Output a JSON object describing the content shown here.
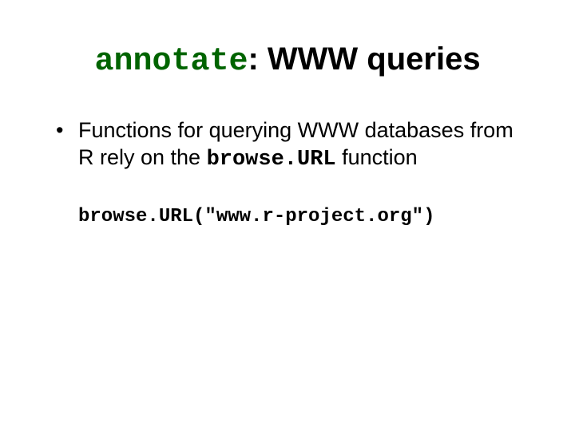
{
  "title": {
    "keyword": "annotate",
    "rest": ": WWW queries"
  },
  "bullets": [
    {
      "text_before": "Functions for querying WWW databases from R rely on the ",
      "code": "browse.URL",
      "text_after": " function"
    }
  ],
  "code_example": "browse.URL(\"www.r-project.org\")"
}
